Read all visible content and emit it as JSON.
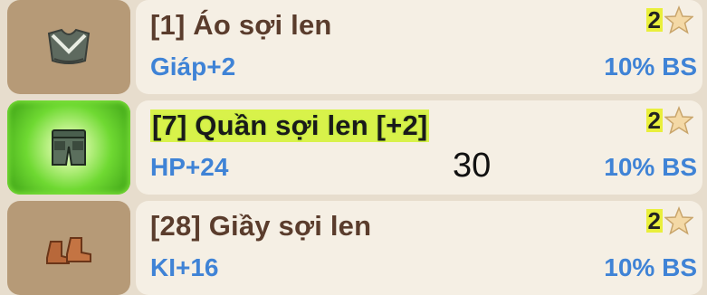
{
  "items": [
    {
      "name": "[1] Áo sợi len",
      "stat": "Giáp+2",
      "percent": "10% BS",
      "stars": "2",
      "icon": "shirt-icon",
      "highlight": false
    },
    {
      "name": "[7] Quần sợi len [+2]",
      "stat": "HP+24",
      "percent": "10% BS",
      "stars": "2",
      "icon": "pants-icon",
      "highlight": true
    },
    {
      "name": "[28] Giầy sợi len",
      "stat": "KI+16",
      "percent": "10% BS",
      "stars": "2",
      "icon": "boots-icon",
      "highlight": false
    }
  ],
  "overlay_number": "30",
  "colors": {
    "name": "#5a3c2c",
    "stat": "#3f83d6",
    "slot": "#b69a77",
    "glow": "#6fd932",
    "card": "#f5efe4"
  }
}
